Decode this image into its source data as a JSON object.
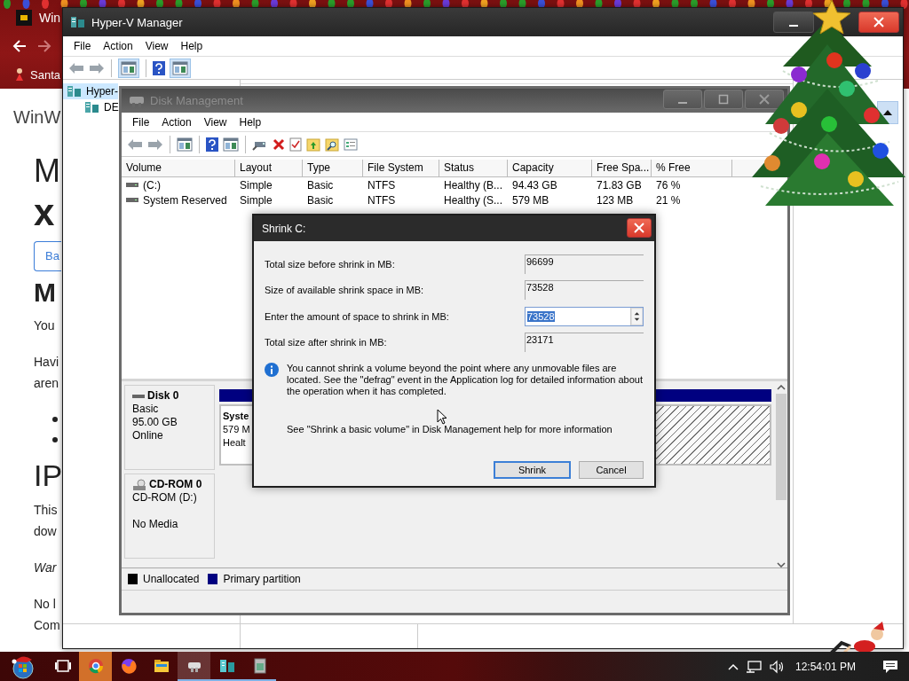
{
  "browser": {
    "tab_title": "Win",
    "bookmark": "Santa",
    "page": [
      {
        "kind": "brand",
        "text": "WinW"
      },
      {
        "kind": "title",
        "text": "M"
      },
      {
        "kind": "title_cont",
        "text": "x"
      },
      {
        "kind": "button",
        "text": "Ba"
      },
      {
        "kind": "heading",
        "text": "M"
      },
      {
        "kind": "lead",
        "text": "You"
      },
      {
        "kind": "p",
        "text": "Havi"
      },
      {
        "kind": "cont",
        "text": "aren"
      },
      {
        "kind": "bullet"
      },
      {
        "kind": "bullet_cont"
      },
      {
        "kind": "heading2",
        "text": "IP"
      },
      {
        "kind": "lead",
        "text": "This"
      },
      {
        "kind": "cont",
        "text": "dow"
      },
      {
        "kind": "em",
        "text": "War"
      },
      {
        "kind": "p",
        "text": "No l"
      },
      {
        "kind": "cont",
        "text": "Com"
      }
    ]
  },
  "hyperv": {
    "title": "Hyper-V Manager",
    "menu": [
      "File",
      "Action",
      "View",
      "Help"
    ],
    "tree": [
      {
        "label": "Hyper-",
        "selected": true,
        "children": [
          {
            "label": "DE",
            "selected": false
          }
        ]
      }
    ]
  },
  "disk_management": {
    "title": "Disk Management",
    "active": false,
    "menu": [
      "File",
      "Action",
      "View",
      "Help"
    ],
    "columns": [
      "Volume",
      "Layout",
      "Type",
      "File System",
      "Status",
      "Capacity",
      "Free Spa...",
      "% Free"
    ],
    "rows": [
      {
        "cells": [
          "(C:)",
          "Simple",
          "Basic",
          "NTFS",
          "Healthy (B...",
          "94.43 GB",
          "71.83 GB",
          "76 %"
        ]
      },
      {
        "cells": [
          "System Reserved",
          "Simple",
          "Basic",
          "NTFS",
          "Healthy (S...",
          "579 MB",
          "123 MB",
          "21 %"
        ]
      }
    ],
    "disks": [
      {
        "kind": "disk",
        "name": "Disk 0",
        "lines": [
          "Basic",
          "95.00 GB",
          "Online"
        ],
        "partitions": [
          {
            "name": "Syste",
            "lines": [
              "579 M",
              "Healt"
            ],
            "selected": false
          },
          {
            "selected": true
          }
        ]
      },
      {
        "kind": "cdrom",
        "name": "CD-ROM 0",
        "lines": [
          "CD-ROM (D:)",
          "No Media"
        ]
      }
    ],
    "legend": [
      {
        "label": "Unallocated",
        "color": "#000000"
      },
      {
        "label": "Primary partition",
        "color": "#000080"
      }
    ]
  },
  "dialog": {
    "title": "Shrink C:",
    "fields": [
      {
        "kind": "readonly",
        "label": "Total size before shrink in MB:",
        "value": "96699"
      },
      {
        "kind": "readonly",
        "label": "Size of available shrink space in MB:",
        "value": "73528"
      },
      {
        "kind": "spin",
        "label": "Enter the amount of space to shrink in MB:",
        "value": "73528",
        "value_selected": true
      },
      {
        "kind": "readonly",
        "label": "Total size after shrink in MB:",
        "value": "23171"
      }
    ],
    "info": "You cannot shrink a volume beyond the point where any unmovable files are located. See the \"defrag\" event in the Application log for detailed information about the operation when it has completed.",
    "help": "See \"Shrink a basic volume\" in Disk Management help for more information",
    "buttons": [
      {
        "label": "Shrink",
        "default": true
      },
      {
        "label": "Cancel",
        "default": false
      }
    ]
  },
  "taskbar": {
    "apps": [
      {
        "kind": "taskview",
        "running": false,
        "active": false,
        "attention": false
      },
      {
        "kind": "chrome",
        "running": false,
        "active": false,
        "attention": true
      },
      {
        "kind": "firefox",
        "running": false,
        "active": false,
        "attention": false
      },
      {
        "kind": "explorer",
        "running": false,
        "active": false,
        "attention": false
      },
      {
        "kind": "disk",
        "running": true,
        "active": true,
        "attention": false
      },
      {
        "kind": "hyperv",
        "running": true,
        "active": false,
        "attention": false
      },
      {
        "kind": "app",
        "running": true,
        "active": false,
        "attention": false
      }
    ],
    "clock": "12:54:01 PM"
  }
}
